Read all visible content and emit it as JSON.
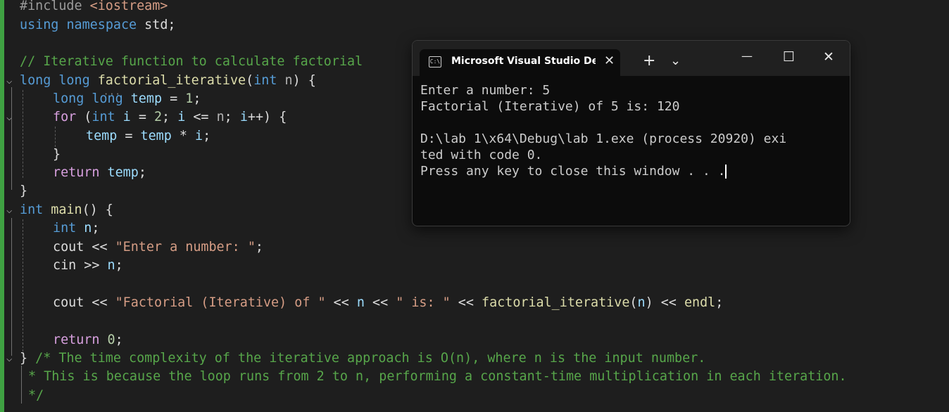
{
  "editor": {
    "lines": {
      "l1": {
        "pp": "#include ",
        "inc": "<iostream>"
      },
      "l2": {
        "kw1": "using",
        "kw2": "namespace",
        "rest": " std;"
      },
      "l4": {
        "comment": "// Iterative function to calculate factorial"
      },
      "l5": {
        "kw": "long long ",
        "fn": "factorial_iterative",
        "p1": "(",
        "kw2": "int",
        "var": " n",
        "p2": ") {"
      },
      "l6": {
        "kw": "long long ",
        "var": "temp",
        "op": " = ",
        "num": "1",
        "end": ";"
      },
      "l7": {
        "ctl": "for",
        "p1": " (",
        "kw": "int",
        "v1": " i",
        "o1": " = ",
        "n1": "2",
        "s1": "; ",
        "v2": "i",
        "o2": " <= ",
        "v3": "n",
        "s2": "; ",
        "v4": "i",
        "o3": "++",
        "end": ") {"
      },
      "l8": {
        "v1": "temp",
        "o1": " = ",
        "v2": "temp",
        "o2": " * ",
        "v3": "i",
        "end": ";"
      },
      "l9": {
        "text": "}"
      },
      "l10": {
        "ctl": "return",
        "var": " temp",
        "end": ";"
      },
      "l11": {
        "text": "}"
      },
      "l12": {
        "kw": "int",
        "fn": " main",
        "end": "() {"
      },
      "l13": {
        "kw": "int",
        "var": " n",
        "end": ";"
      },
      "l14": {
        "v": "cout",
        "op": " << ",
        "str": "\"Enter a number: \"",
        "end": ";"
      },
      "l15": {
        "v": "cin",
        "op": " >> ",
        "var": "n",
        "end": ";"
      },
      "l17": {
        "v": "cout",
        "o1": " << ",
        "s1": "\"Factorial (Iterative) of \"",
        "o2": " << ",
        "var": "n",
        "o3": " << ",
        "s2": "\" is: \"",
        "o4": " << ",
        "fn": "factorial_iterative",
        "p1": "(",
        "arg": "n",
        "p2": ")",
        "o5": " << ",
        "endl": "endl",
        "end": ";"
      },
      "l19": {
        "ctl": "return",
        "num": " 0",
        "end": ";"
      },
      "l20": {
        "brace": "}",
        "comment": " /* The time complexity of the iterative approach is O(n), where n is the input number."
      },
      "l21": {
        "comment": "* This is because the loop runs from 2 to n, performing a constant-time multiplication in each iteration."
      },
      "l22": {
        "comment": "*/"
      }
    }
  },
  "terminal": {
    "tab_title": "Microsoft Visual Studio Debu",
    "icon_text": "C:\\",
    "close_tab_glyph": "✕",
    "new_tab_glyph": "+",
    "dropdown_glyph": "⌄",
    "minimize_glyph": "—",
    "maximize_glyph": "☐",
    "close_glyph": "✕",
    "output": [
      "Enter a number: 5",
      "Factorial (Iterative) of 5 is: 120",
      "",
      "D:\\lab 1\\x64\\Debug\\lab 1.exe (process 20920) exi",
      "ted with code 0.",
      "Press any key to close this window . . ."
    ]
  },
  "colors": {
    "editor_bg": "#1e1e1e",
    "change_bar": "#3fa142",
    "keyword": "#569cd6",
    "control": "#d8a0df",
    "function": "#dcdcaa",
    "variable": "#9cdcfe",
    "string": "#d69d85",
    "number": "#b5cea8",
    "comment": "#57a64a",
    "terminal_bg": "#0c0c0c"
  }
}
